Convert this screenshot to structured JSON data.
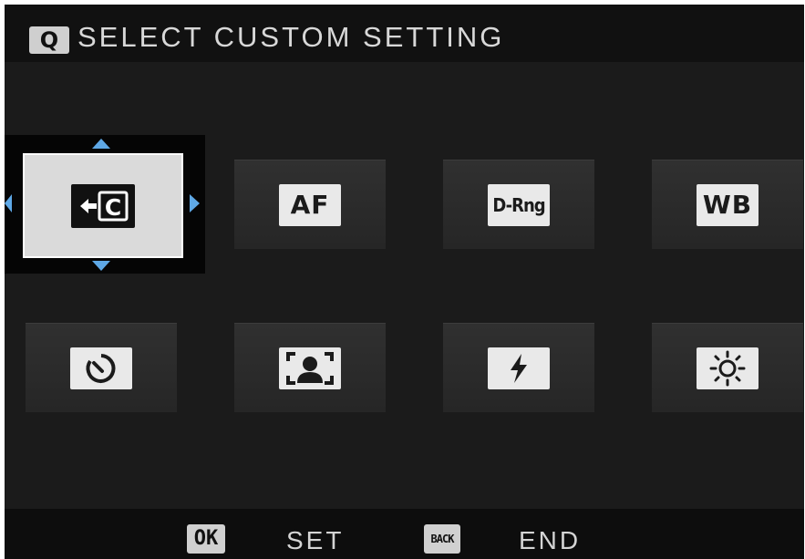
{
  "header": {
    "badge": "Q",
    "title": "SELECT CUSTOM SETTING"
  },
  "tiles": [
    {
      "name": "edit-custom-setting",
      "icon": "edit-custom-icon",
      "text": "C",
      "selected": true
    },
    {
      "name": "af",
      "icon": "af-icon",
      "text": "AF"
    },
    {
      "name": "d-range",
      "icon": "d-range-icon",
      "text": "D-Rng"
    },
    {
      "name": "white-balance",
      "icon": "white-balance-icon",
      "text": "WB"
    },
    {
      "name": "self-timer",
      "icon": "self-timer-icon"
    },
    {
      "name": "face-detection",
      "icon": "face-detection-icon"
    },
    {
      "name": "flash",
      "icon": "flash-icon"
    },
    {
      "name": "brightness",
      "icon": "brightness-icon"
    }
  ],
  "footer": {
    "ok_badge": "OK",
    "ok_label": "SET",
    "back_badge": "BACK",
    "back_label": "END"
  },
  "colors": {
    "accent": "#5ea8e6",
    "background": "#1b1b1b",
    "tile": "#2b2b2b",
    "selected_tile": "#dadada"
  }
}
